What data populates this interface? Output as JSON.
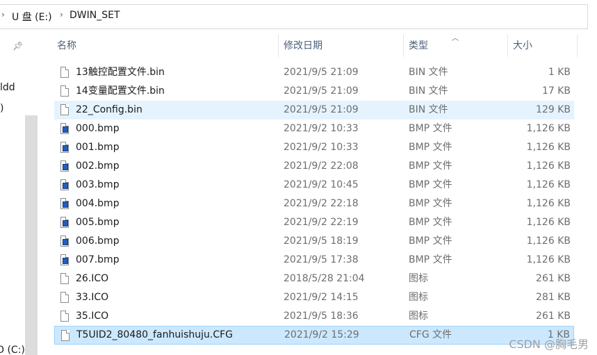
{
  "breadcrumb": {
    "drive": "U 盘 (E:)",
    "folder": "DWIN_SET"
  },
  "nav": {
    "items": [
      "ldd",
      ")",
      "O (C:)"
    ]
  },
  "columns": {
    "name": "名称",
    "date": "修改日期",
    "type": "类型",
    "size": "大小"
  },
  "sort": {
    "column": "type",
    "direction": "ascending"
  },
  "files": [
    {
      "name": "13触控配置文件.bin",
      "date": "2021/9/5 21:09",
      "type": "BIN 文件",
      "size": "1 KB",
      "icon": "file-icon"
    },
    {
      "name": "14变量配置文件.bin",
      "date": "2021/9/5 21:09",
      "type": "BIN 文件",
      "size": "17 KB",
      "icon": "file-icon"
    },
    {
      "name": "22_Config.bin",
      "date": "2021/9/5 21:09",
      "type": "BIN 文件",
      "size": "129 KB",
      "icon": "file-icon"
    },
    {
      "name": "000.bmp",
      "date": "2021/9/2 10:33",
      "type": "BMP 文件",
      "size": "1,126 KB",
      "icon": "bmp-icon"
    },
    {
      "name": "001.bmp",
      "date": "2021/9/2 10:33",
      "type": "BMP 文件",
      "size": "1,126 KB",
      "icon": "bmp-icon"
    },
    {
      "name": "002.bmp",
      "date": "2021/9/2 22:08",
      "type": "BMP 文件",
      "size": "1,126 KB",
      "icon": "bmp-icon"
    },
    {
      "name": "003.bmp",
      "date": "2021/9/2 10:45",
      "type": "BMP 文件",
      "size": "1,126 KB",
      "icon": "bmp-icon"
    },
    {
      "name": "004.bmp",
      "date": "2021/9/2 22:18",
      "type": "BMP 文件",
      "size": "1,126 KB",
      "icon": "bmp-icon"
    },
    {
      "name": "005.bmp",
      "date": "2021/9/2 22:19",
      "type": "BMP 文件",
      "size": "1,126 KB",
      "icon": "bmp-icon"
    },
    {
      "name": "006.bmp",
      "date": "2021/9/5 18:19",
      "type": "BMP 文件",
      "size": "1,126 KB",
      "icon": "bmp-icon"
    },
    {
      "name": "007.bmp",
      "date": "2021/9/5 17:38",
      "type": "BMP 文件",
      "size": "1,126 KB",
      "icon": "bmp-icon"
    },
    {
      "name": "26.ICO",
      "date": "2018/5/28 21:04",
      "type": "图标",
      "size": "261 KB",
      "icon": "file-icon"
    },
    {
      "name": "33.ICO",
      "date": "2021/9/2 14:15",
      "type": "图标",
      "size": "281 KB",
      "icon": "file-icon"
    },
    {
      "name": "35.ICO",
      "date": "2021/9/5 18:36",
      "type": "图标",
      "size": "261 KB",
      "icon": "file-icon"
    },
    {
      "name": "T5UID2_80480_fanhuishuju.CFG",
      "date": "2021/9/2 15:29",
      "type": "CFG 文件",
      "size": "1 KB",
      "icon": "file-icon"
    }
  ],
  "hovered_row": 2,
  "selected_row": 14,
  "watermark": "CSDN @胸毛男",
  "colors": {
    "hover": "#e5f3ff",
    "selected": "#cce8ff",
    "selected_border": "#99d1ff",
    "header_text": "#4c607a"
  }
}
